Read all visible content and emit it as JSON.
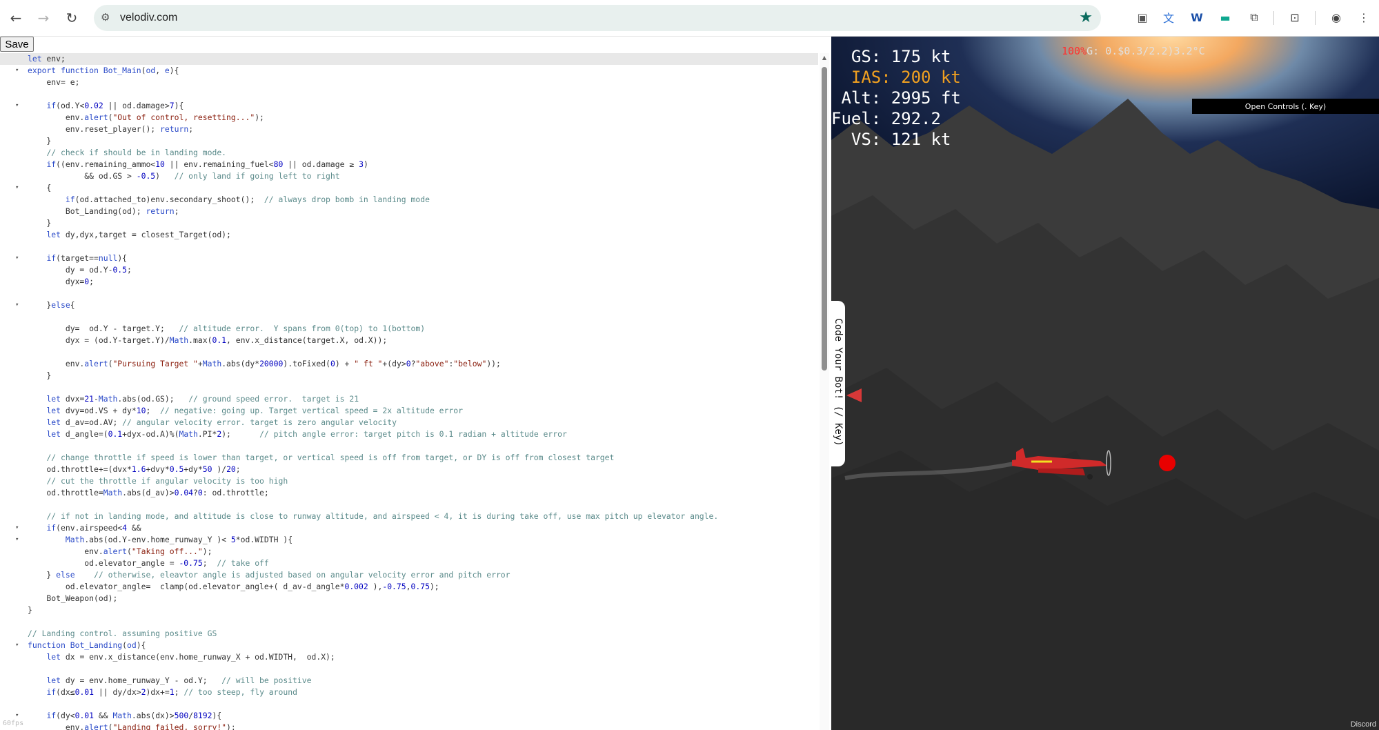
{
  "browser": {
    "url": "velodiv.com",
    "icons": [
      "back-icon",
      "forward-icon",
      "reload-icon",
      "site-settings-icon",
      "bookmark-star-icon",
      "extension-icons",
      "profile-icon",
      "menu-icon"
    ]
  },
  "toolbar": {
    "save_label": "Save"
  },
  "editor": {
    "fps": "60fps",
    "lines": [
      {
        "fold": "",
        "html": "<span class=\"kw\">let</span> env;"
      },
      {
        "fold": "▾",
        "html": "<span class=\"kw\">export function</span> <span class=\"kw\">Bot_Main</span>(<span class=\"kw\">od</span>, <span class=\"kw\">e</span>){"
      },
      {
        "fold": "",
        "html": "    env= e;"
      },
      {
        "fold": "",
        "html": ""
      },
      {
        "fold": "▾",
        "html": "    <span class=\"kw\">if</span>(od.Y<<span class=\"nm\">0.02</span> || od.damage><span class=\"nm\">7</span>){"
      },
      {
        "fold": "",
        "html": "        env.<span class=\"kw\">alert</span>(<span class=\"st\">\"Out of control, resetting...\"</span>);"
      },
      {
        "fold": "",
        "html": "        env.reset_player(); <span class=\"kw\">return</span>;"
      },
      {
        "fold": "",
        "html": "    }"
      },
      {
        "fold": "",
        "html": "    <span class=\"cm\">// check if should be in landing mode.</span>"
      },
      {
        "fold": "",
        "html": "    <span class=\"kw\">if</span>((env.remaining_ammo<<span class=\"nm\">10</span> || env.remaining_fuel<<span class=\"nm\">80</span> || od.damage ≥ <span class=\"nm\">3</span>)"
      },
      {
        "fold": "",
        "html": "            && od.GS > <span class=\"nm\">-0.5</span>)   <span class=\"cm\">// only land if going left to right</span>"
      },
      {
        "fold": "▾",
        "html": "    {"
      },
      {
        "fold": "",
        "html": "        <span class=\"kw\">if</span>(od.attached_to)env.secondary_shoot();  <span class=\"cm\">// always drop bomb in landing mode</span>"
      },
      {
        "fold": "",
        "html": "        Bot_Landing(od); <span class=\"kw\">return</span>;"
      },
      {
        "fold": "",
        "html": "    }"
      },
      {
        "fold": "",
        "html": "    <span class=\"kw\">let</span> dy,dyx,target = closest_Target(od);"
      },
      {
        "fold": "",
        "html": ""
      },
      {
        "fold": "▾",
        "html": "    <span class=\"kw\">if</span>(target==<span class=\"kw\">null</span>){"
      },
      {
        "fold": "",
        "html": "        dy = od.Y-<span class=\"nm\">0.5</span>;"
      },
      {
        "fold": "",
        "html": "        dyx=<span class=\"nm\">0</span>;"
      },
      {
        "fold": "",
        "html": ""
      },
      {
        "fold": "▾",
        "html": "    }<span class=\"kw\">else</span>{"
      },
      {
        "fold": "",
        "html": ""
      },
      {
        "fold": "",
        "html": "        dy=  od.Y - target.Y;   <span class=\"cm\">// altitude error.  Y spans from 0(top) to 1(bottom)</span>"
      },
      {
        "fold": "",
        "html": "        dyx = (od.Y-target.Y)/<span class=\"kw\">Math</span>.max(<span class=\"nm\">0.1</span>, env.x_distance(target.X, od.X));"
      },
      {
        "fold": "",
        "html": ""
      },
      {
        "fold": "",
        "html": "        env.<span class=\"kw\">alert</span>(<span class=\"st\">\"Pursuing Target \"</span>+<span class=\"kw\">Math</span>.abs(dy*<span class=\"nm\">20000</span>).toFixed(<span class=\"nm\">0</span>) + <span class=\"st\">\" ft \"</span>+(dy><span class=\"nm\">0</span>?<span class=\"st\">\"above\"</span>:<span class=\"st\">\"below\"</span>));"
      },
      {
        "fold": "",
        "html": "    }"
      },
      {
        "fold": "",
        "html": ""
      },
      {
        "fold": "",
        "html": "    <span class=\"kw\">let</span> dvx=<span class=\"nm\">21</span>-<span class=\"kw\">Math</span>.abs(od.GS);   <span class=\"cm\">// ground speed error.  target is 21</span>"
      },
      {
        "fold": "",
        "html": "    <span class=\"kw\">let</span> dvy=od.VS + dy*<span class=\"nm\">10</span>;  <span class=\"cm\">// negative: going up. Target vertical speed = 2x altitude error</span>"
      },
      {
        "fold": "",
        "html": "    <span class=\"kw\">let</span> d_av=od.AV; <span class=\"cm\">// angular velocity error. target is zero angular velocity</span>"
      },
      {
        "fold": "",
        "html": "    <span class=\"kw\">let</span> d_angle=(<span class=\"nm\">0.1</span>+dyx-od.A)%(<span class=\"kw\">Math</span>.PI*<span class=\"nm\">2</span>);      <span class=\"cm\">// pitch angle error: target pitch is 0.1 radian + altitude error</span>"
      },
      {
        "fold": "",
        "html": ""
      },
      {
        "fold": "",
        "html": "    <span class=\"cm\">// change throttle if speed is lower than target, or vertical speed is off from target, or DY is off from closest target</span>"
      },
      {
        "fold": "",
        "html": "    od.throttle+=(dvx*<span class=\"nm\">1.6</span>+dvy*<span class=\"nm\">0.5</span>+dy*<span class=\"nm\">50</span> )/<span class=\"nm\">20</span>;"
      },
      {
        "fold": "",
        "html": "    <span class=\"cm\">// cut the throttle if angular velocity is too high</span>"
      },
      {
        "fold": "",
        "html": "    od.throttle=<span class=\"kw\">Math</span>.abs(d_av)><span class=\"nm\">0.04</span>?<span class=\"nm\">0</span>: od.throttle;"
      },
      {
        "fold": "",
        "html": ""
      },
      {
        "fold": "",
        "html": "    <span class=\"cm\">// if not in landing mode, and altitude is close to runway altitude, and airspeed < 4, it is during take off, use max pitch up elevator angle.</span>"
      },
      {
        "fold": "▾",
        "html": "    <span class=\"kw\">if</span>(env.airspeed<<span class=\"nm\">4</span> &&"
      },
      {
        "fold": "▾",
        "html": "        <span class=\"kw\">Math</span>.abs(od.Y-env.home_runway_Y )< <span class=\"nm\">5</span>*od.WIDTH ){"
      },
      {
        "fold": "",
        "html": "            env.<span class=\"kw\">alert</span>(<span class=\"st\">\"Taking off...\"</span>);"
      },
      {
        "fold": "",
        "html": "            od.elevator_angle = <span class=\"nm\">-0.75</span>;  <span class=\"cm\">// take off</span>"
      },
      {
        "fold": "",
        "html": "    } <span class=\"kw\">else</span>    <span class=\"cm\">// otherwise, eleavtor angle is adjusted based on angular velocity error and pitch error</span>"
      },
      {
        "fold": "",
        "html": "        od.elevator_angle=  clamp(od.elevator_angle+( d_av-d_angle*<span class=\"nm\">0.002</span> ),<span class=\"nm\">-0.75</span>,<span class=\"nm\">0.75</span>);"
      },
      {
        "fold": "",
        "html": "    Bot_Weapon(od);"
      },
      {
        "fold": "",
        "html": "}"
      },
      {
        "fold": "",
        "html": ""
      },
      {
        "fold": "",
        "html": "<span class=\"cm\">// Landing control. assuming positive GS</span>"
      },
      {
        "fold": "▾",
        "html": "<span class=\"kw\">function</span> <span class=\"kw\">Bot_Landing</span>(<span class=\"kw\">od</span>){"
      },
      {
        "fold": "",
        "html": "    <span class=\"kw\">let</span> dx = env.x_distance(env.home_runway_X + od.WIDTH,  od.X);"
      },
      {
        "fold": "",
        "html": ""
      },
      {
        "fold": "",
        "html": "    <span class=\"kw\">let</span> dy = env.home_runway_Y - od.Y;   <span class=\"cm\">// will be positive</span>"
      },
      {
        "fold": "",
        "html": "    <span class=\"kw\">if</span>(dx≤<span class=\"nm\">0.01</span> || dy/dx><span class=\"nm\">2</span>)dx+=<span class=\"nm\">1</span>; <span class=\"cm\">// too steep, fly around</span>"
      },
      {
        "fold": "",
        "html": ""
      },
      {
        "fold": "▾",
        "html": "    <span class=\"kw\">if</span>(dy<<span class=\"nm\">0.01</span> && <span class=\"kw\">Math</span>.abs(dx)><span class=\"nm\">500</span>/<span class=\"nm\">8192</span>){"
      },
      {
        "fold": "",
        "html": "        env.<span class=\"kw\">alert</span>(<span class=\"st\">\"Landing failed, sorry!\"</span>);"
      }
    ]
  },
  "hud": {
    "gs": "  GS: 175 kt",
    "ias": "  IAS: 200 kt",
    "alt": " Alt: 2995 ft",
    "fuel": "Fuel: 292.2",
    "vs": "  VS: 121 kt",
    "top_red": "100%",
    "top_rest": "G: 0.$0.3/2.2)3.2°C"
  },
  "game": {
    "open_controls": "Open Controls (. Key)",
    "code_tab": "Code Your Bot! (/ Key)",
    "discord": "Discord"
  }
}
